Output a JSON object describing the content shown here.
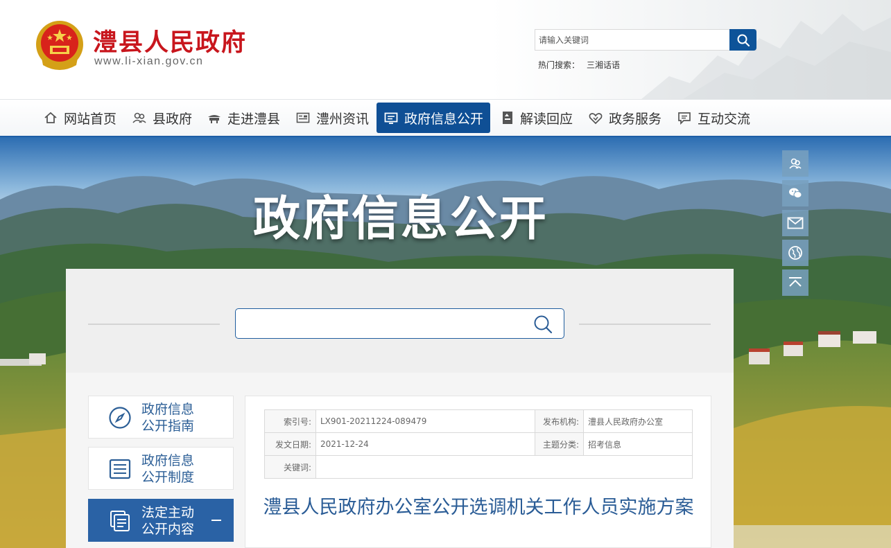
{
  "header": {
    "site_title": "澧县人民政府",
    "site_domain": "www.li-xian.gov.cn",
    "search_placeholder": "请输入关键词",
    "hot_search_label": "热门搜索：",
    "hot_search_items": [
      "三湘话语"
    ]
  },
  "nav": {
    "items": [
      {
        "label": "网站首页",
        "icon": "home-icon"
      },
      {
        "label": "县政府",
        "icon": "people-icon"
      },
      {
        "label": "走进澧县",
        "icon": "pavilion-icon"
      },
      {
        "label": "澧州资讯",
        "icon": "news-card-icon"
      },
      {
        "label": "政府信息公开",
        "icon": "info-screen-icon",
        "active": true
      },
      {
        "label": "解读回应",
        "icon": "book-icon"
      },
      {
        "label": "政务服务",
        "icon": "heart-hand-icon"
      },
      {
        "label": "互动交流",
        "icon": "chat-icon"
      }
    ]
  },
  "banner": {
    "title": "政府信息公开"
  },
  "float_bar": [
    "weibo-icon",
    "wechat-icon",
    "mail-icon",
    "globe-icon",
    "back-to-top-icon"
  ],
  "sidebar": {
    "items": [
      {
        "line1": "政府信息",
        "line2": "公开指南",
        "icon": "compass-icon"
      },
      {
        "line1": "政府信息",
        "line2": "公开制度",
        "icon": "list-doc-icon"
      },
      {
        "line1": "法定主动",
        "line2": "公开内容",
        "icon": "stacked-doc-icon",
        "active": true
      }
    ]
  },
  "meta": {
    "index_no_label": "索引号:",
    "index_no": "LX901-20211224-089479",
    "publisher_label": "发布机构:",
    "publisher": "澧县人民政府办公室",
    "date_label": "发文日期:",
    "date": "2021-12-24",
    "topic_label": "主题分类:",
    "topic": "招考信息",
    "keywords_label": "关键词:",
    "keywords": ""
  },
  "article": {
    "title": "澧县人民政府办公室公开选调机关工作人员实施方案"
  },
  "colors": {
    "brand_red": "#c8161d",
    "nav_active": "#0f4f95",
    "link_blue": "#2b5e96"
  }
}
